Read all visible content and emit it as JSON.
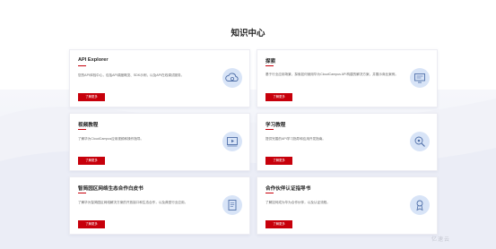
{
  "page": {
    "title": "知识中心"
  },
  "cards": [
    {
      "title": "API Explorer",
      "description": "您的API体验中心，包括API调度概览、SDK示例，以及API在线调试服务。",
      "button_label": "了解更多",
      "icon": "cloud-api-icon"
    },
    {
      "title": "探索",
      "description": "基于行业应用场景，探索如何使用华为CloudCampus API构建的解决方案，并展示商业案例。",
      "button_label": "了解更多",
      "icon": "monitor-explore-icon"
    },
    {
      "title": "视频教程",
      "description": "了解华为CloudCampus应用视频和操作指导。",
      "button_label": "了解更多",
      "icon": "video-player-icon"
    },
    {
      "title": "学习教程",
      "description": "提供完善的API学习指导和应用开发指南。",
      "button_label": "了解更多",
      "icon": "magnifier-gear-icon"
    },
    {
      "title": "智简园区网络生态合作白皮书",
      "description": "了解华为智简园区网络解决方案的开放接口和生态合作，以及典型行业应用。",
      "button_label": "了解更多",
      "icon": "document-icon"
    },
    {
      "title": "合作伙伴认证指导书",
      "description": "了解如何成为华为合作伙伴，以及认证流程。",
      "button_label": "了解更多",
      "icon": "certificate-icon"
    }
  ],
  "watermark": "亿速云",
  "colors": {
    "accent_red": "#c7000b",
    "icon_bg": "#d8e4f7",
    "icon_stroke": "#4f6fa8"
  }
}
